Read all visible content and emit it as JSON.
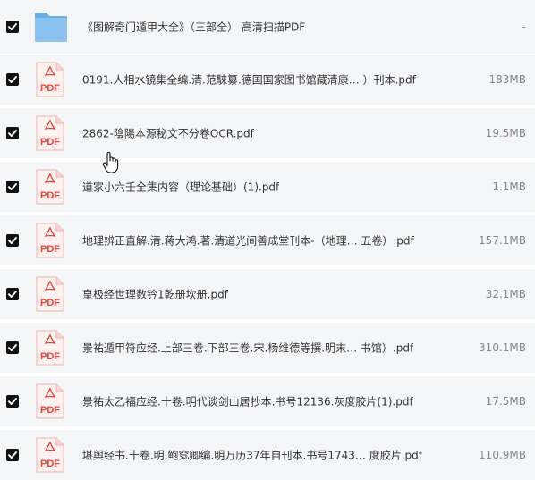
{
  "file_list": {
    "rows": [
      {
        "name": "《图解奇门遁甲大全》（三部全） 高清扫描PDF",
        "size": "-",
        "type": "folder",
        "checked": true
      },
      {
        "name": "0191.人相水镜集全编.清.范騋纂.德国国家图书馆藏清康…  ）刊本.pdf",
        "size": "183MB",
        "type": "pdf",
        "checked": true
      },
      {
        "name": "2862-陰陽本源秘文不分卷OCR.pdf",
        "size": "19.5MB",
        "type": "pdf",
        "checked": true
      },
      {
        "name": "道家小六壬全集内容（理论基础）(1).pdf",
        "size": "1.1MB",
        "type": "pdf",
        "checked": true
      },
      {
        "name": "地理辨正直解.清.蒋大鸿.著.清道光间善成堂刊本-（地理…  五卷）.pdf",
        "size": "157.1MB",
        "type": "pdf",
        "checked": true
      },
      {
        "name": "皇极经世理数钤1乾册坎册.pdf",
        "size": "32.1MB",
        "type": "pdf",
        "checked": true
      },
      {
        "name": "景祐遁甲符应经.上部三卷.下部三卷.宋.杨维德等撰.明末…  书馆）.pdf",
        "size": "310.1MB",
        "type": "pdf",
        "checked": true
      },
      {
        "name": "景祐太乙福应经.十卷.明代谈剑山居抄本.书号12136.灰度胶片(1).pdf",
        "size": "17.5MB",
        "type": "pdf",
        "checked": true
      },
      {
        "name": "堪舆经书.十卷.明.鲍䆒卿编.明万历37年自刊本.书号1743… 度胶片.pdf",
        "size": "110.9MB",
        "type": "pdf",
        "checked": true
      }
    ]
  },
  "icons": {
    "folder": "folder-icon",
    "pdf": "pdf-file-icon",
    "checkbox": "checkbox-checked-icon",
    "cursor": "hand-pointer-cursor-icon",
    "pdf_label": "PDF"
  },
  "colors": {
    "row_background": "#f5f6f8",
    "pdf_red": "#e8453c",
    "folder_blue": "#7ab6ec",
    "checkbox": "#111111",
    "size_text": "#888888"
  }
}
